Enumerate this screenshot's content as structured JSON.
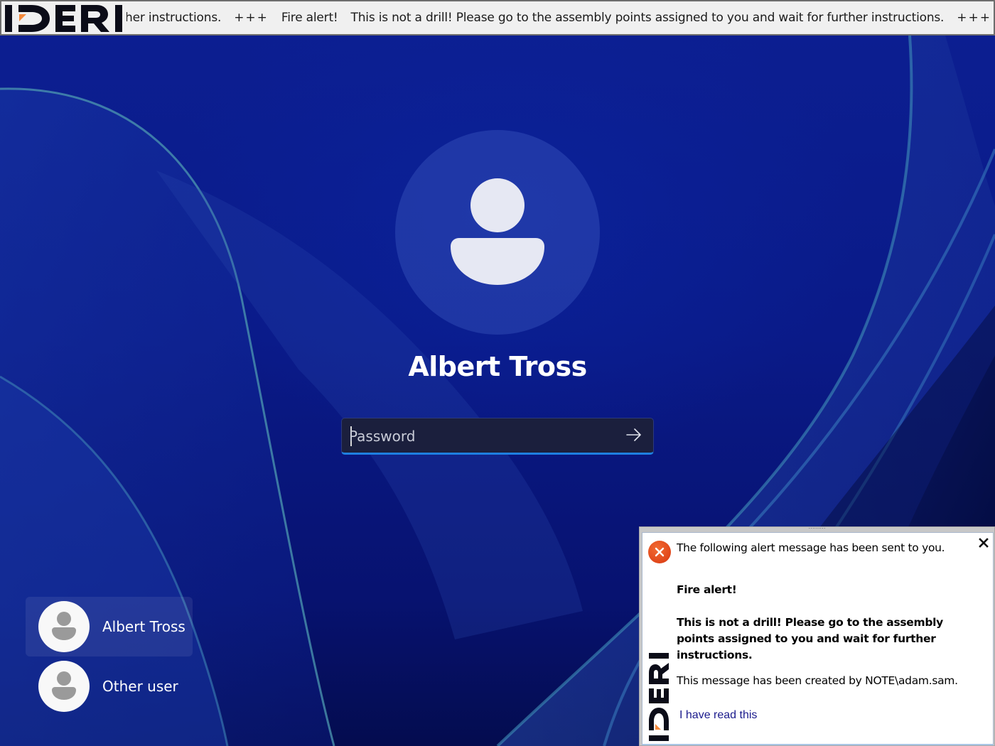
{
  "ticker": {
    "logo_text": "IDERI",
    "segments": [
      "her instructions.",
      "+++",
      "Fire alert!",
      "This is not a drill! Please go to the assembly points assigned to you and wait for further instructions.",
      "+++",
      "Fire alert!"
    ]
  },
  "login": {
    "user_name": "Albert Tross",
    "password_placeholder": "Password",
    "submit_icon": "arrow-right-icon"
  },
  "user_list": [
    {
      "name": "Albert Tross",
      "selected": true,
      "icon": "user-avatar-icon"
    },
    {
      "name": "Other user",
      "selected": false,
      "icon": "user-avatar-icon"
    }
  ],
  "alert": {
    "grip": "·········",
    "icon": "error-x-icon",
    "intro": "The following alert message has been sent to you.",
    "title": "Fire alert!",
    "message": "This is not a drill! Please go to the assembly points assigned to you and wait for further instructions.",
    "creator": "This message has been created by NOTE\\adam.sam.",
    "read_link": "I have read this",
    "close_icon": "close-icon",
    "logo_text": "IDERI"
  },
  "colors": {
    "accent_blue": "#1e7fe0",
    "alert_red": "#e0461a",
    "logo_orange": "#f58a3c",
    "link_blue": "#1a1a8c"
  }
}
